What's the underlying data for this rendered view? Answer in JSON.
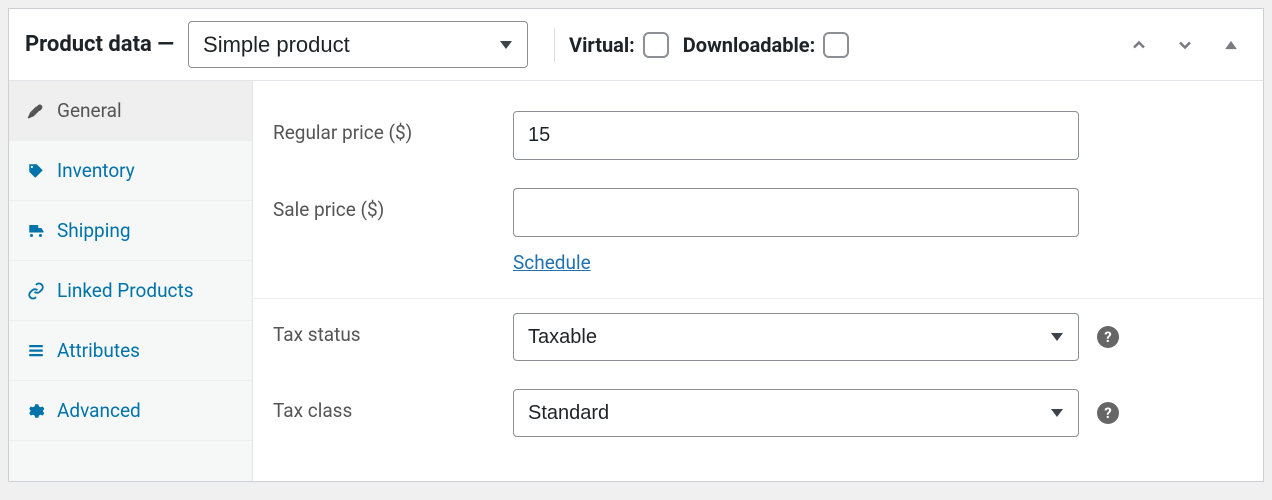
{
  "header": {
    "title": "Product data —",
    "product_type": "Simple product",
    "virtual_label": "Virtual:",
    "downloadable_label": "Downloadable:"
  },
  "sidebar": {
    "items": [
      {
        "label": "General"
      },
      {
        "label": "Inventory"
      },
      {
        "label": "Shipping"
      },
      {
        "label": "Linked Products"
      },
      {
        "label": "Attributes"
      },
      {
        "label": "Advanced"
      }
    ]
  },
  "form": {
    "regular_price_label": "Regular price ($)",
    "regular_price_value": "15",
    "sale_price_label": "Sale price ($)",
    "sale_price_value": "",
    "schedule_label": "Schedule",
    "tax_status_label": "Tax status",
    "tax_status_value": "Taxable",
    "tax_class_label": "Tax class",
    "tax_class_value": "Standard"
  }
}
